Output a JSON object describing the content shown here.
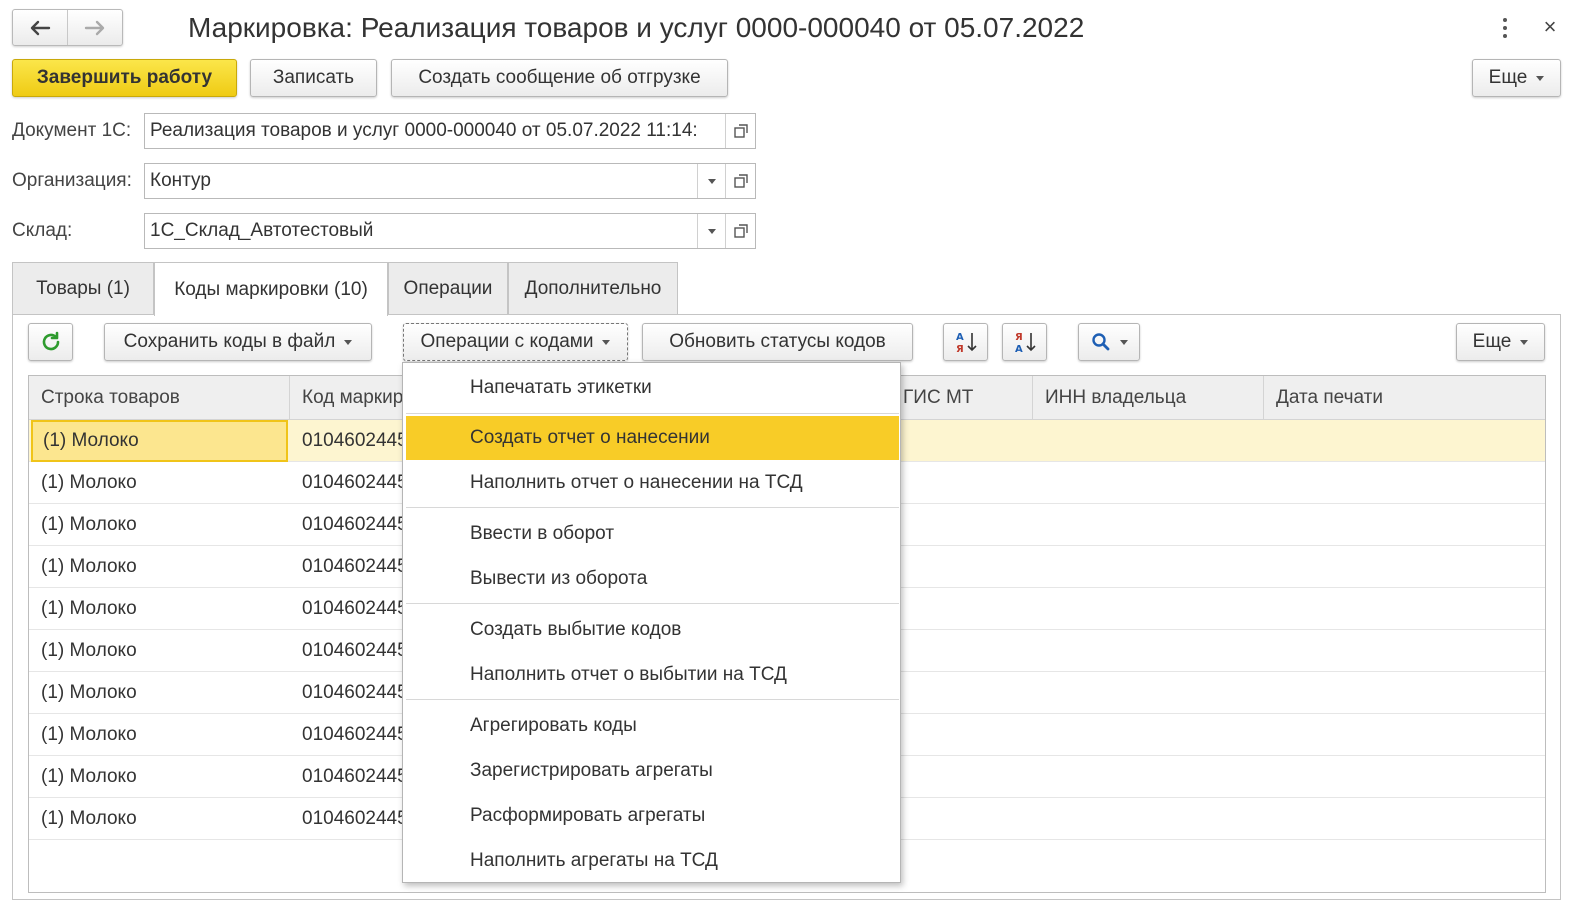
{
  "window": {
    "title": "Маркировка: Реализация товаров и услуг 0000-000040 от 05.07.2022",
    "close_glyph": "×"
  },
  "nav": {
    "back_glyph": "🡐",
    "forward_glyph": "🡒"
  },
  "toolbar": {
    "finish_label": "Завершить работу",
    "save_label": "Записать",
    "create_message_label": "Создать сообщение об отгрузке",
    "more_label": "Еще"
  },
  "form": {
    "document_label": "Документ 1С:",
    "document_value": "Реализация товаров и услуг 0000-000040 от 05.07.2022 11:14:",
    "organization_label": "Организация:",
    "organization_value": "Контур",
    "warehouse_label": "Склад:",
    "warehouse_value": "1С_Склад_Автотестовый"
  },
  "tabs": [
    {
      "label": "Товары (1)"
    },
    {
      "label": "Коды маркировки (10)",
      "active": true
    },
    {
      "label": "Операции"
    },
    {
      "label": "Дополнительно"
    }
  ],
  "tab_toolbar": {
    "save_codes_label": "Сохранить коды в файл",
    "operations_label": "Операции с кодами",
    "refresh_statuses_label": "Обновить статусы кодов",
    "more_label": "Еще"
  },
  "table": {
    "columns": [
      "Строка товаров",
      "Код маркир",
      "ГИС МТ",
      "ИНН владельца",
      "Дата печати"
    ],
    "rows": [
      {
        "row": "(1) Молоко",
        "code": "0104602445"
      },
      {
        "row": "(1) Молоко",
        "code": "0104602445"
      },
      {
        "row": "(1) Молоко",
        "code": "0104602445"
      },
      {
        "row": "(1) Молоко",
        "code": "0104602445"
      },
      {
        "row": "(1) Молоко",
        "code": "0104602445"
      },
      {
        "row": "(1) Молоко",
        "code": "0104602445"
      },
      {
        "row": "(1) Молоко",
        "code": "0104602445"
      },
      {
        "row": "(1) Молоко",
        "code": "0104602445"
      },
      {
        "row": "(1) Молоко",
        "code": "0104602445"
      },
      {
        "row": "(1) Молоко",
        "code": "0104602445"
      }
    ]
  },
  "menu": {
    "items": [
      "Напечатать этикетки",
      "Создать отчет о нанесении",
      "Наполнить отчет о нанесении на ТСД",
      "Ввести в оборот",
      "Вывести из оборота",
      "Создать выбытие кодов",
      "Наполнить отчет о выбытии на ТСД",
      "Агрегировать коды",
      "Зарегистрировать агрегаты",
      "Расформировать агрегаты",
      "Наполнить агрегаты на ТСД"
    ],
    "highlighted_index": 1
  },
  "colors": {
    "primary_button": "#f5d62b",
    "menu_highlight": "#f8cc27",
    "selected_row": "#fdf5d0",
    "refresh_icon": "#2e9b2e",
    "sort_icon": "#1e5fb4"
  }
}
